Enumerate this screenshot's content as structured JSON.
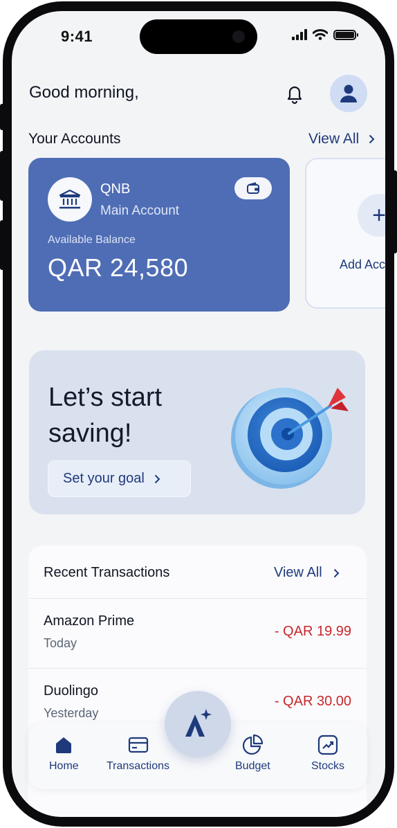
{
  "status_bar": {
    "time": "9:41"
  },
  "header": {
    "greeting": "Good morning,"
  },
  "accounts": {
    "title": "Your Accounts",
    "view_all": "View All",
    "primary": {
      "bank": "QNB",
      "type": "Main Account",
      "balance_label": "Available Balance",
      "balance": "QAR 24,580"
    },
    "add_label": "Add Acc"
  },
  "savings": {
    "title": "Let’s start saving!",
    "button": "Set your goal"
  },
  "transactions": {
    "title": "Recent Transactions",
    "view_all": "View All",
    "items": [
      {
        "name": "Amazon Prime",
        "date": "Today",
        "amount": "- QAR 19.99"
      },
      {
        "name": "Duolingo",
        "date": "Yesterday",
        "amount": "- QAR 30.00"
      }
    ]
  },
  "nav": {
    "items": [
      {
        "label": "Home",
        "icon": "home-icon"
      },
      {
        "label": "Transactions",
        "icon": "card-icon"
      },
      {
        "label": "Budget",
        "icon": "pie-chart-icon"
      },
      {
        "label": "Stocks",
        "icon": "trend-icon"
      }
    ],
    "active": "Home"
  },
  "colors": {
    "primary": "#1e3a7b",
    "card": "#4f6db5",
    "expense": "#c7272b",
    "background": "#f3f4f6"
  }
}
